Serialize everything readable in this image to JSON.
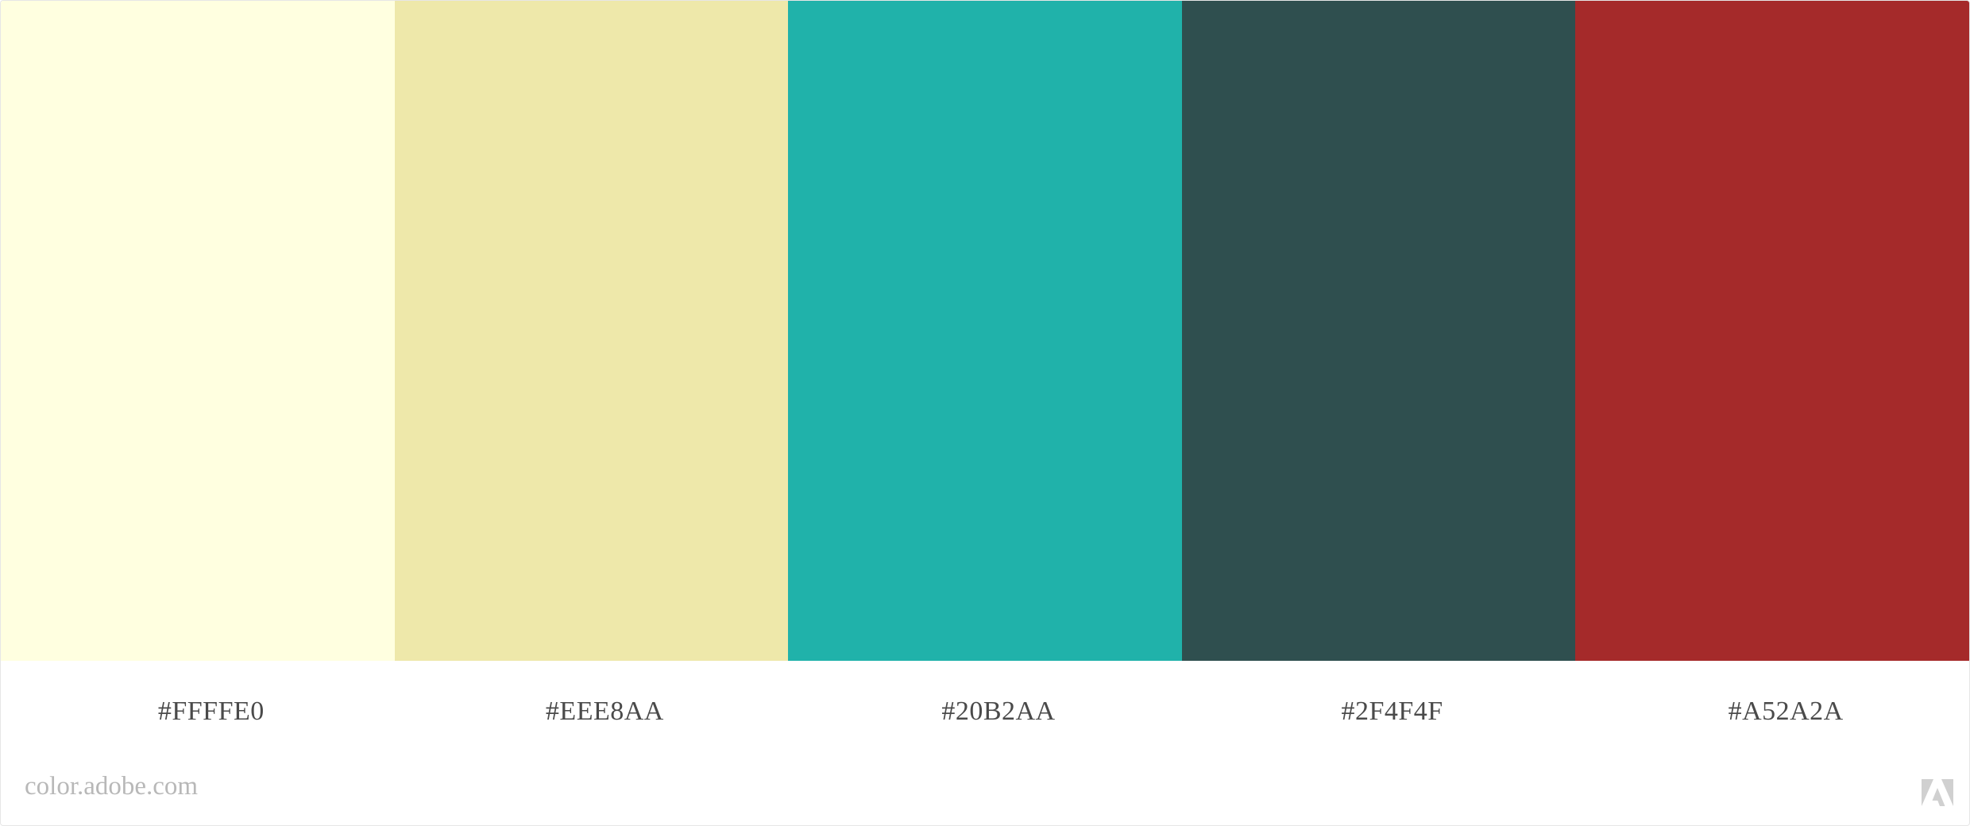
{
  "palette": {
    "swatches": [
      {
        "hex": "#FFFFE0",
        "color": "#FFFFE0"
      },
      {
        "hex": "#EEE8AA",
        "color": "#EEE8AA"
      },
      {
        "hex": "#20B2AA",
        "color": "#20B2AA"
      },
      {
        "hex": "#2F4F4F",
        "color": "#2F4F4F"
      },
      {
        "hex": "#A52A2A",
        "color": "#A52A2A"
      }
    ]
  },
  "footer": {
    "site": "color.adobe.com",
    "logo_icon": "adobe-logo-icon",
    "logo_color": "#d0d0d0"
  }
}
